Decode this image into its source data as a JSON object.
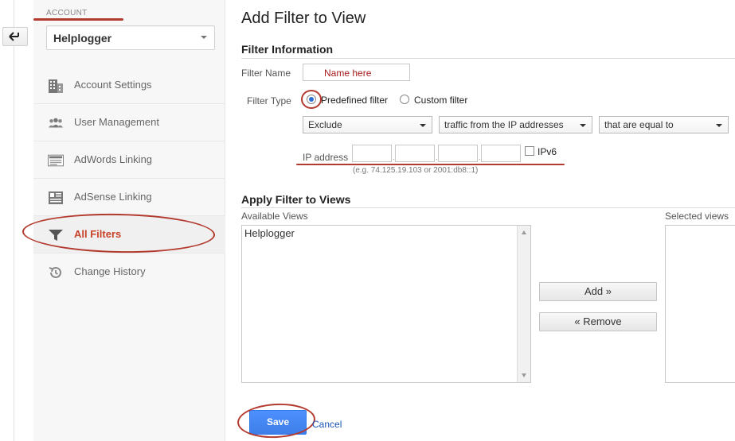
{
  "sidebar": {
    "account_label": "ACCOUNT",
    "account_name": "Helplogger",
    "items": [
      {
        "label": "Account Settings",
        "icon": "building-icon"
      },
      {
        "label": "User Management",
        "icon": "users-icon"
      },
      {
        "label": "AdWords Linking",
        "icon": "adwords-icon"
      },
      {
        "label": "AdSense Linking",
        "icon": "adsense-icon"
      },
      {
        "label": "All Filters",
        "icon": "filter-icon",
        "active": true
      },
      {
        "label": "Change History",
        "icon": "history-icon"
      }
    ]
  },
  "main": {
    "title": "Add Filter to View",
    "filter_info": {
      "section_title": "Filter Information",
      "name_label": "Filter Name",
      "name_value": "Name here",
      "type_label": "Filter Type",
      "radio_predefined": "Predefined filter",
      "radio_custom": "Custom filter",
      "selected_type": "Predefined filter",
      "dropdown_action": "Exclude",
      "dropdown_source": "traffic from the IP addresses",
      "dropdown_match": "that are equal to",
      "ip_label": "IP address",
      "ipv6_label": "IPv6",
      "ip_hint": "(e.g. 74.125.19.103 or 2001:db8::1)"
    },
    "apply": {
      "section_title": "Apply Filter to Views",
      "available_label": "Available Views",
      "selected_label": "Selected views",
      "available_views": [
        "Helplogger"
      ],
      "add_button": "Add »",
      "remove_button": "« Remove"
    },
    "save_button": "Save",
    "cancel_link": "Cancel"
  },
  "colors": {
    "annotation_red": "#b33a2e",
    "active_nav": "#c8432a",
    "save_blue": "#4d90fe",
    "link_blue": "#1a55b8"
  }
}
